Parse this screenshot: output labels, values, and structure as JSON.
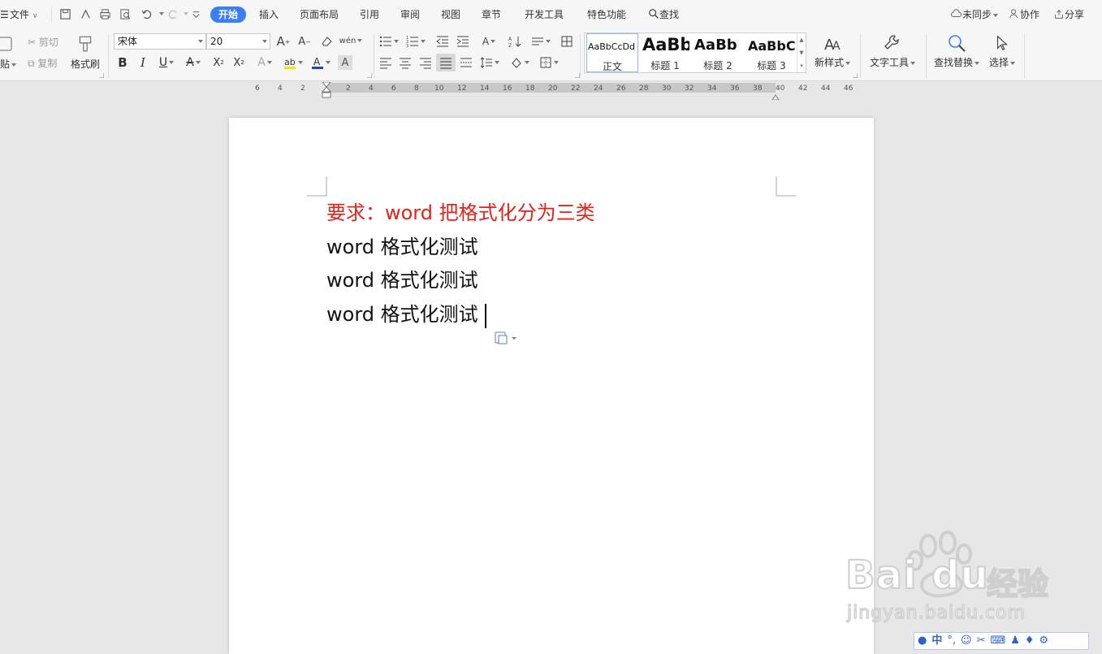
{
  "menubar": {
    "file_label": "文件",
    "tabs": [
      {
        "label": "开始",
        "active": true
      },
      {
        "label": "插入"
      },
      {
        "label": "页面布局"
      },
      {
        "label": "引用"
      },
      {
        "label": "审阅"
      },
      {
        "label": "视图"
      },
      {
        "label": "章节"
      },
      {
        "label": "开发工具"
      },
      {
        "label": "特色功能"
      }
    ],
    "search_label": "查找",
    "sync_label": "未同步",
    "collab_label": "协作",
    "share_label": "分享"
  },
  "ribbon": {
    "paste_label": "贴",
    "cut_label": "剪切",
    "copy_label": "复制",
    "format_painter_label": "格式刷",
    "font_name": "宋体",
    "font_size": "20",
    "styles": [
      {
        "sample": "AaBbCcDd",
        "name": "正文"
      },
      {
        "sample": "AaBb",
        "name": "标题 1"
      },
      {
        "sample": "AaBb",
        "name": "标题 2"
      },
      {
        "sample": "AaBbC",
        "name": "标题 3"
      }
    ],
    "new_style_label": "新样式",
    "text_tools_label": "文字工具",
    "find_replace_label": "查找替换",
    "select_label": "选择"
  },
  "ruler": {
    "left_numbers": [
      "6",
      "4",
      "2"
    ],
    "right_numbers": [
      "2",
      "4",
      "6",
      "8",
      "10",
      "12",
      "14",
      "16",
      "18",
      "20",
      "22",
      "24",
      "26",
      "28",
      "30",
      "32",
      "34",
      "36",
      "38",
      "40",
      "42",
      "44",
      "46"
    ]
  },
  "document": {
    "lines": [
      {
        "text": "要求：word 把格式化分为三类",
        "color": "#e2231a"
      },
      {
        "text": "word 格式化测试",
        "color": "#111111"
      },
      {
        "text": "word 格式化测试",
        "color": "#111111"
      },
      {
        "text": "word 格式化测试",
        "color": "#111111"
      }
    ]
  },
  "watermark": {
    "brand": "Bai du",
    "brand_cn": "经验",
    "url": "jingyan.baidu.com"
  },
  "ime": {
    "mode": "中"
  },
  "colors": {
    "accent": "#3a7ff5",
    "heading_red": "#e2231a"
  }
}
